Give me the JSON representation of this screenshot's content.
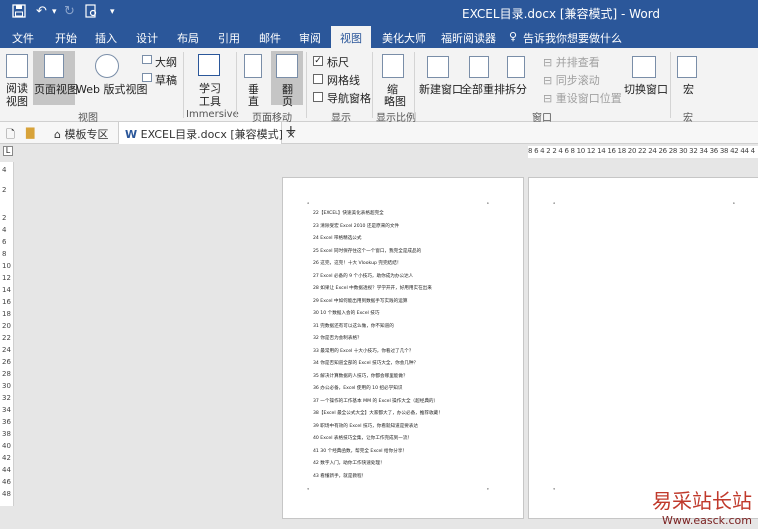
{
  "window": {
    "title": "EXCEL目录.docx [兼容模式] - Word"
  },
  "tabs": [
    "文件",
    "开始",
    "插入",
    "设计",
    "布局",
    "引用",
    "邮件",
    "审阅",
    "视图",
    "美化大师",
    "福昕阅读器",
    "告诉我你想要做什么"
  ],
  "ribbon": {
    "read_mode": "阅读\n视图",
    "read_mode_1": "阅读",
    "read_mode_2": "视图",
    "print_layout": "页面视图",
    "web_layout": "Web 版式视图",
    "outline": "大纲",
    "draft": "草稿",
    "group_views": "视图",
    "learning_tools_1": "学习",
    "learning_tools_2": "工具",
    "group_immersive": "Immersive",
    "vertical_1": "垂",
    "vertical_2": "直",
    "side_to_side_1": "翻",
    "side_to_side_2": "页",
    "group_page_movement": "页面移动",
    "ruler": "标尺",
    "gridlines": "网格线",
    "nav_pane": "导航窗格",
    "group_show": "显示",
    "zoom_1": "缩",
    "zoom_2": "略图",
    "group_zoom": "显示比例",
    "new_window": "新建窗口",
    "arrange_all": "全部重排",
    "split": "拆分",
    "view_side_by_side": "并排查看",
    "sync_scroll": "同步滚动",
    "reset_window": "重设窗口位置",
    "switch_windows": "切换窗口",
    "group_window": "窗口",
    "macros": "宏",
    "group_macros": "宏"
  },
  "doctabs": {
    "templates": "模板专区",
    "document": "EXCEL目录.docx [兼容模式]",
    "close": "×",
    "add": "+"
  },
  "ruler": {
    "numbers": "8 6 4 2 2 4 6 8 10 12 14 16 18 20 22 24 26 28 30 32 34 36 38 42 44 4",
    "vertical": [
      "4",
      "2",
      "2",
      "4",
      "6",
      "8",
      "10",
      "12",
      "14",
      "16",
      "18",
      "20",
      "22",
      "24",
      "26",
      "28",
      "30",
      "32",
      "34",
      "36",
      "38",
      "40",
      "42",
      "44",
      "46",
      "48"
    ]
  },
  "document_lines": [
    "22【EXCEL】快速美化表格超完全",
    "23 清除受宏 Excel 2010 还是原来的文件",
    "24 Excel 带格精选公式",
    "25 Excel 同时保存住这个一个窗口，我完全是成品的",
    "26 这完，这完！十大 Vlookup 完完结结！",
    "27 Excel 必备的 9 个小技巧，助你成为办公达人",
    "28 如果让 Excel 中数据透视？学学开开，好用用实在出来",
    "29 Excel 中如何能出用到数据手写实践的运算",
    "30 10 个数据入会的 Excel 技巧",
    "31 完数据还有可以这么做，你不知道的",
    "32 你是否为会制表格？",
    "33 最常用的 Excel 十大小技巧，你看过了几个？",
    "34 你是否知道全部的 Excel 技巧大全，你会几种？",
    "35 解决计算数据的人技巧，你都会哪里能做？",
    "36 办公必备，Excel 使用的 10 招必学知识",
    "37 一个操作的工作基本 MM 的 Excel 操作大全（超经典的）",
    "38【Excel 最全公式大全】大家都大了，办公必备，推荐收藏！",
    "39 职场中有效的 Excel 技巧，你看就知道是要表达",
    "40 Excel 表格技巧全集，让你工作完成到一流！",
    "41 30 个经典函数，帮完全 Excel 给你分享！",
    "42 数字入门，助你工作快速处理！",
    "43 看懂新手，就是教程！"
  ],
  "watermark": {
    "title": "易采站长站",
    "url": "Www.easck.com"
  }
}
